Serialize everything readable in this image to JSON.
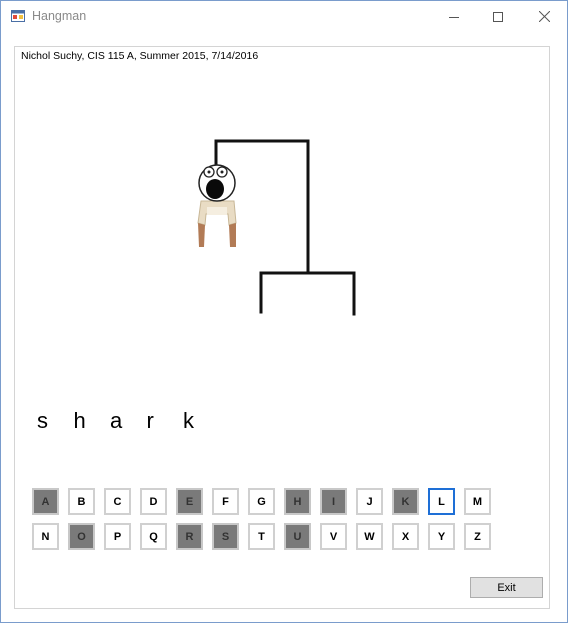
{
  "window": {
    "title": "Hangman"
  },
  "credit": "Nichol Suchy, CIS 115 A, Summer 2015, 7/14/2016",
  "word": {
    "letters": [
      "s",
      "h",
      "a",
      "r",
      "k"
    ]
  },
  "keyboard": {
    "row1": [
      {
        "letter": "A",
        "state": "used"
      },
      {
        "letter": "B",
        "state": "available"
      },
      {
        "letter": "C",
        "state": "available"
      },
      {
        "letter": "D",
        "state": "available"
      },
      {
        "letter": "E",
        "state": "used"
      },
      {
        "letter": "F",
        "state": "available"
      },
      {
        "letter": "G",
        "state": "available"
      },
      {
        "letter": "H",
        "state": "used"
      },
      {
        "letter": "I",
        "state": "used"
      },
      {
        "letter": "J",
        "state": "available"
      },
      {
        "letter": "K",
        "state": "used"
      },
      {
        "letter": "L",
        "state": "focused"
      },
      {
        "letter": "M",
        "state": "available"
      }
    ],
    "row2": [
      {
        "letter": "N",
        "state": "available"
      },
      {
        "letter": "O",
        "state": "used"
      },
      {
        "letter": "P",
        "state": "available"
      },
      {
        "letter": "Q",
        "state": "available"
      },
      {
        "letter": "R",
        "state": "used"
      },
      {
        "letter": "S",
        "state": "used"
      },
      {
        "letter": "T",
        "state": "available"
      },
      {
        "letter": "U",
        "state": "used"
      },
      {
        "letter": "V",
        "state": "available"
      },
      {
        "letter": "W",
        "state": "available"
      },
      {
        "letter": "X",
        "state": "available"
      },
      {
        "letter": "Y",
        "state": "available"
      },
      {
        "letter": "Z",
        "state": "available"
      }
    ]
  },
  "exit_label": "Exit",
  "colors": {
    "used_key": "#7a7a7a",
    "focus_border": "#1e6fd6",
    "gallows": "#111111"
  }
}
